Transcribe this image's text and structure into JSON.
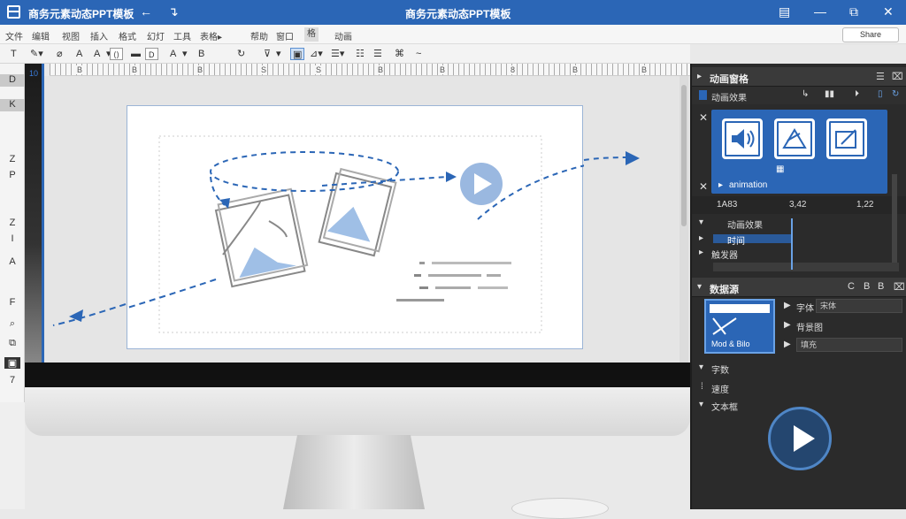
{
  "window": {
    "title_left": "商务元素动态PPT模板",
    "title_center": "商务元素动态PPT模板",
    "back": "←",
    "forward": "↴",
    "controls": [
      "▤",
      "—",
      "⧉",
      "✕"
    ]
  },
  "menu": {
    "items": [
      "文件",
      "编辑",
      "视图",
      "插入",
      "格式",
      "幻灯",
      "工具",
      "表格▸",
      "帮助",
      "窗口",
      "格",
      "动画"
    ],
    "share": "Share"
  },
  "toolbar": {
    "items": [
      "T",
      "✎▾",
      "⌀",
      "A",
      "A",
      "▾",
      "⟨⟩",
      "▬",
      "D",
      "A",
      "▾",
      "B",
      "↻",
      "⊽",
      "▾",
      "▣",
      "⊿▾",
      "☰▾",
      "☷",
      "☰",
      "⌘",
      "~"
    ]
  },
  "ruler_h": [
    "B",
    "B",
    "B",
    "S",
    "S",
    "B",
    "B",
    "8",
    "B",
    "B"
  ],
  "ruler_v": {
    "label": "10"
  },
  "left_tools": [
    "D",
    "K",
    "Z",
    "P",
    "Z",
    "I",
    "A",
    "F",
    "⌕",
    "⧉",
    "▣",
    "7"
  ],
  "right_panel": {
    "anim_panel": {
      "title": "动画窗格",
      "icons": [
        "☰",
        "⌧"
      ]
    },
    "sub_row": {
      "label": "动画效果",
      "icons": [
        "↳",
        "▮▮",
        "⏵",
        "▯",
        "↻"
      ]
    },
    "anim_caption": "animation",
    "anim_tile_caption": "▦",
    "time_values": [
      "1A83",
      "3,42",
      "1,22"
    ],
    "tracks": [
      {
        "label": "动画效果",
        "arrow": "▾"
      },
      {
        "label": "时间",
        "arrow": "▸"
      },
      {
        "label": "触发器",
        "arrow": "▸"
      }
    ],
    "data_panel": {
      "title": "数据源",
      "icons": [
        "C",
        "B",
        "B",
        "⌧"
      ]
    },
    "data_fields": [
      {
        "label": "字体",
        "value": "宋体"
      },
      {
        "label": "背景图",
        "value": ""
      },
      {
        "label": "",
        "value": "填充"
      }
    ],
    "thumb_caption": "Mod & Bilo",
    "sections": [
      {
        "label": "字数",
        "arrow": "▾"
      },
      {
        "label": "速度",
        "arrow": "⁞"
      },
      {
        "label": "文本框",
        "arrow": "▾"
      }
    ]
  },
  "colors": {
    "accent": "#2b66b6",
    "panel_dark": "#2b2b2b",
    "title_bar": "#2b66b6"
  }
}
